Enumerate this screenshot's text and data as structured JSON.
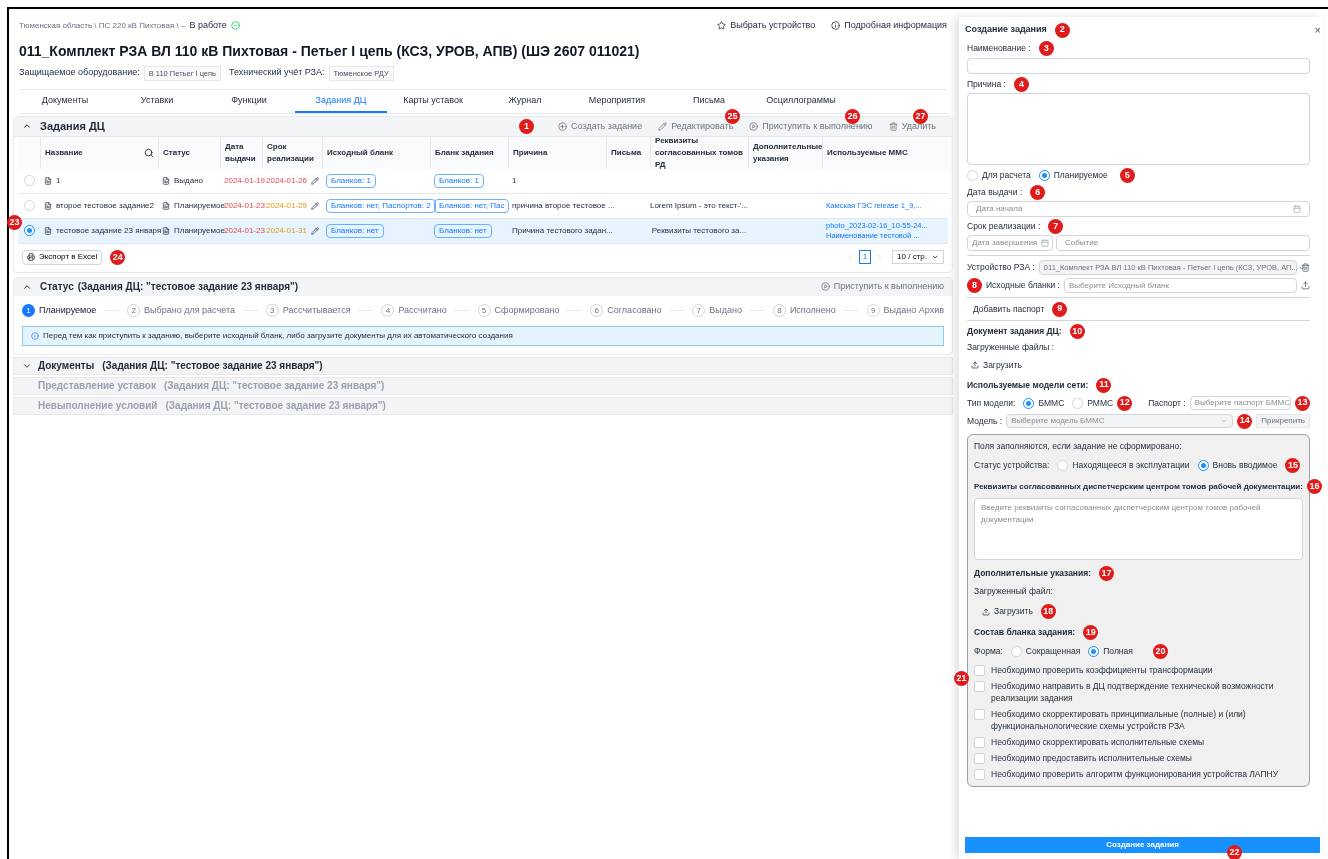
{
  "breadcrumb": {
    "path": "Тюменская область \\ ПС 220 кВ Пихтовая \\ –",
    "status": "В работе"
  },
  "header_actions": [
    {
      "kind": "star",
      "label": "Выбрать устройство"
    },
    {
      "kind": "info",
      "label": "Подробная информация"
    }
  ],
  "title": "011_Комплект РЗА ВЛ 110 кВ Пихтовая - Петьег I цепь (КСЗ, УРОВ, АПВ) (ШЭ 2607 011021)",
  "meta": [
    {
      "label": "Защищаемое оборудование:",
      "value": "В 110 Петьег I цепь"
    },
    {
      "label": "Технический учёт РЗА:",
      "value": "Тюменское РДУ"
    }
  ],
  "tabs": [
    {
      "label": "Документы",
      "selected": false
    },
    {
      "label": "Уставки",
      "selected": false
    },
    {
      "label": "Функции",
      "selected": false
    },
    {
      "label": "Задания ДЦ",
      "selected": true
    },
    {
      "label": "Карты уставок",
      "selected": false
    },
    {
      "label": "Журнал",
      "selected": false
    },
    {
      "label": "Мероприятия",
      "selected": false
    },
    {
      "label": "Письма",
      "selected": false
    },
    {
      "label": "Осциллограммы",
      "selected": false
    }
  ],
  "tasks": {
    "title": "Задания ДЦ",
    "expanded": true,
    "marker": "1",
    "actions": [
      {
        "kind": "create",
        "label": "Создать задание"
      },
      {
        "kind": "edit",
        "label": "Редактировать",
        "marker": "25"
      },
      {
        "kind": "start",
        "label": "Приступить к выполнению",
        "marker": "26"
      },
      {
        "kind": "delete",
        "label": "Удалить",
        "marker": "27"
      }
    ],
    "table": {
      "columns": [
        "Название",
        "Статус",
        "Дата выдачи",
        "Срок реализации",
        "Исходный бланк",
        "Бланк задания",
        "Причина",
        "Письма",
        "Реквизиты согласованных томов РД",
        "Дополнительные указания",
        "Используемые ММС"
      ],
      "rows": [
        {
          "selected": false,
          "name": "1",
          "status": "Выдано",
          "issued": "2024-01-19",
          "deadline": "2024-01-26",
          "overdue": true,
          "source": "Бланков: 1",
          "blank": "Бланков: 1",
          "reason": "1",
          "requisites": null,
          "mms": []
        },
        {
          "selected": false,
          "name": "второе тестовое задание2",
          "status": "Планируемое",
          "issued": "2024-01-23",
          "deadline": "2024-01-29",
          "overdue": false,
          "source": "Бланков: нет, Паспортов: 2",
          "blank": "Бланков: нет, Пас",
          "reason": "причина второе тестовое ...",
          "requisites": "Lorem Ipsum - это текст-'...",
          "mms": [
            "Камская ГЭС release 1_9,..."
          ]
        },
        {
          "selected": true,
          "marker": "23",
          "name": "тестовое задание 23 января",
          "status": "Планируемое",
          "issued": "2024-01-23",
          "deadline": "2024-01-31",
          "overdue": false,
          "source": "Бланков: нет",
          "blank": "Бланков: нет",
          "reason": "Причина тестового задан...",
          "requisites": "Реквизиты тестового за...",
          "mms": [
            "photo_2023-02-16_10-55-24...",
            "Наименование тестовой ..."
          ]
        }
      ]
    },
    "export": {
      "label": "Экспорт в Excel",
      "marker": "24"
    },
    "pagination": {
      "page": "1",
      "size": "10 / стр."
    }
  },
  "status": {
    "title": "Статус",
    "context": "(Задания ДЦ: \"тестовое задание 23 января\")",
    "action": "Приступить к выполнению",
    "steps": [
      {
        "number": "1",
        "label": "Планируемое",
        "active": true
      },
      {
        "number": "2",
        "label": "Выбрано для расчета",
        "active": false
      },
      {
        "number": "3",
        "label": "Рассчитывается",
        "active": false
      },
      {
        "number": "4",
        "label": "Рассчитано",
        "active": false
      },
      {
        "number": "5",
        "label": "Сформировано",
        "active": false
      },
      {
        "number": "6",
        "label": "Согласовано",
        "active": false
      },
      {
        "number": "7",
        "label": "Выдано",
        "active": false
      },
      {
        "number": "8",
        "label": "Исполнено",
        "active": false
      },
      {
        "number": "9",
        "label": "Выдано Архив",
        "active": false
      }
    ],
    "alert": "Перед тем как приступить к заданию, выберите исходный бланк, либо загрузите документы для их автоматического создания"
  },
  "collapsed_panels": [
    {
      "title": "Документы",
      "context": "(Задания ДЦ: \"тестовое задание 23 января\")",
      "disabled": false
    },
    {
      "title": "Представление уставок",
      "context": "(Задания ДЦ: \"тестовое задание 23 января\")",
      "disabled": true
    },
    {
      "title": "Невыполнение условий",
      "context": "(Задания ДЦ: \"тестовое задание 23 января\")",
      "disabled": true
    }
  ],
  "drawer": {
    "title": "Создание задания",
    "marker": "2",
    "close": "×",
    "name_field": {
      "label": "Наименование :",
      "marker": "3"
    },
    "reason_field": {
      "label": "Причина :",
      "marker": "4"
    },
    "purpose": {
      "marker": "5",
      "options": [
        {
          "label": "Для расчета",
          "selected": false
        },
        {
          "label": "Планируемое",
          "selected": true
        }
      ]
    },
    "issue_date": {
      "label": "Дата выдачи :",
      "marker": "6",
      "placeholder": "Дата начала"
    },
    "deadline": {
      "label": "Срок реализации :",
      "marker": "7",
      "date_placeholder": "Дата завершения",
      "event_placeholder": "Событие"
    },
    "device": {
      "label": "Устройство РЗА :",
      "value": "011_Комплект РЗА ВЛ 110 кВ Пихтовая - Петьег I цепь (КСЗ, УРОВ, АП...",
      "disabled": true
    },
    "source_blanks": {
      "label": "Исходные бланки :",
      "marker": "8",
      "placeholder": "Выберите Исходный бланк"
    },
    "add_passport": {
      "label": "Добавить паспорт",
      "marker": "9"
    },
    "document": {
      "label": "Документ задания ДЦ:",
      "marker": "10",
      "files_label": "Загруженные файлы :",
      "upload": "Загрузить"
    },
    "models": {
      "label": "Используемые модели сети:",
      "marker": "11",
      "type_label": "Тип модели:",
      "types": [
        {
          "label": "БММС",
          "selected": true
        },
        {
          "label": "РММС",
          "selected": false
        }
      ],
      "type_marker": "12",
      "passport_label": "Паспорт :",
      "passport_placeholder": "Выберите паспорт БММС",
      "passport_marker": "13",
      "model_label": "Модель :",
      "model_placeholder": "Выберите модель БММС",
      "model_disabled": true,
      "model_marker": "14",
      "attach": "Прикрепить"
    },
    "extra": {
      "note": "Поля заполняются, если задание не сформировано:",
      "device_status_label": "Статус устройства:",
      "device_status": [
        {
          "label": "Находящееся в эксплуатации",
          "selected": false
        },
        {
          "label": "Вновь вводимое",
          "selected": true
        }
      ],
      "device_status_marker": "15",
      "requisites_label": "Реквизиты согласованных диспетчерским центром томов рабочей документации:",
      "requisites_marker": "16",
      "requisites_placeholder": "Введите реквизиты согласованных диспетчерским центром томов рабочей документации",
      "instructions_label": "Дополнительные указания:",
      "instructions_marker": "17",
      "file_label": "Загруженный файл:",
      "upload": "Загрузить",
      "upload_marker": "18",
      "composition_label": "Состав бланка задания:",
      "composition_marker": "19",
      "form_label": "Форма:",
      "forms": [
        {
          "label": "Сокращенная",
          "selected": false
        },
        {
          "label": "Полная",
          "selected": true
        }
      ],
      "forms_marker": "20",
      "checks_marker": "21",
      "checks": [
        {
          "label": "Необходимо проверить коэффициенты трансформации",
          "checked": false
        },
        {
          "label": "Необходимо направить в ДЦ подтверждение технической возможности реализации задания",
          "checked": false
        },
        {
          "label": "Необходимо скорректировать принципиальные (полные) и (или) функциональнологические схемы устройств РЗА",
          "checked": false
        },
        {
          "label": "Необходимо скорректировать исполнительные схемы",
          "checked": false
        },
        {
          "label": "Необходимо предоставить исполнительные схемы",
          "checked": false
        },
        {
          "label": "Необходимо проверить алгоритм функционирования устройства ЛАПНУ",
          "checked": false
        }
      ]
    },
    "submit": {
      "label": "Создание задания",
      "marker": "22"
    }
  }
}
